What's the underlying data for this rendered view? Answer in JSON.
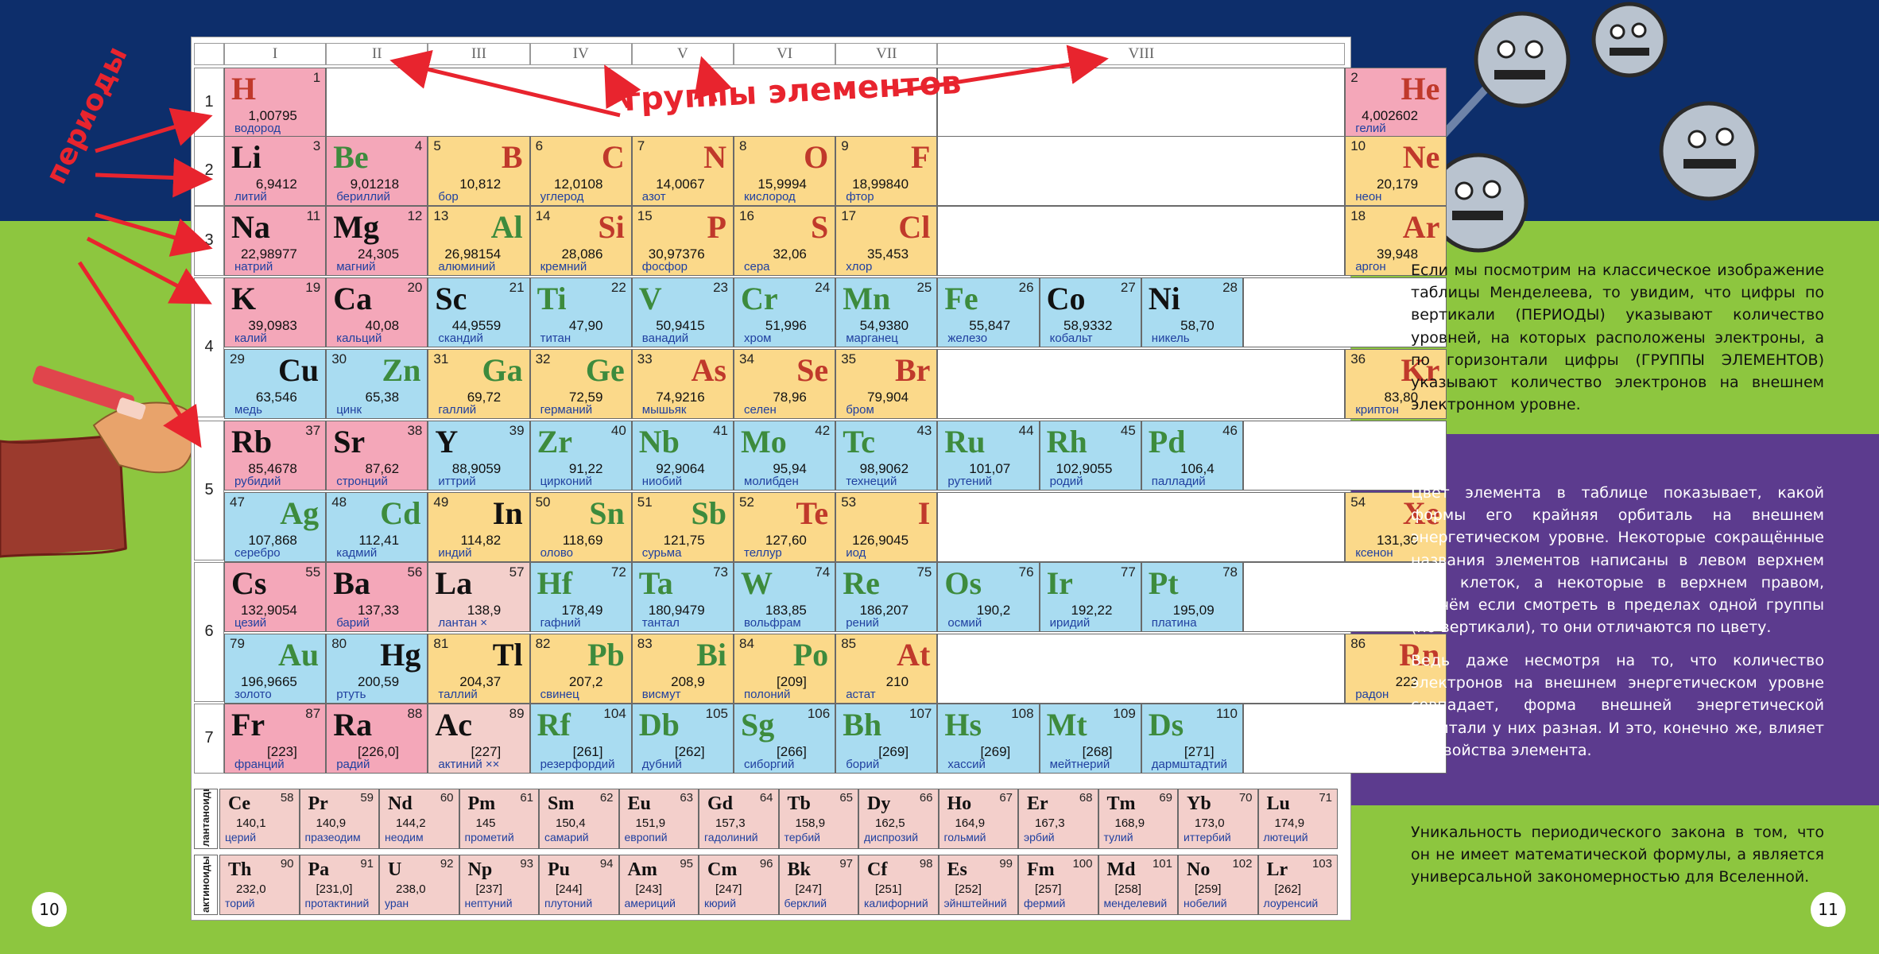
{
  "groups_label": "группы элементов",
  "periods_label": "периоды",
  "group_headers": [
    "I",
    "II",
    "III",
    "IV",
    "V",
    "VI",
    "VII",
    "VIII"
  ],
  "period_numbers": [
    "1",
    "2",
    "3",
    "4",
    "5",
    "6",
    "7"
  ],
  "colors": {
    "s": "#f4a7b9",
    "p": "#fbd98a",
    "d": "#a9dcf1",
    "f": "#f3cfcb"
  },
  "elements": [
    {
      "sym": "H",
      "num": "1",
      "mass": "1,00795",
      "name": "водород",
      "block": "s",
      "sc": "#c0392b",
      "nr": true
    },
    {
      "sym": "He",
      "num": "2",
      "mass": "4,002602",
      "name": "гелий",
      "block": "s",
      "sc": "#c0392b",
      "nr": false
    },
    {
      "sym": "Li",
      "num": "3",
      "mass": "6,9412",
      "name": "литий",
      "block": "s",
      "sc": "#111",
      "nr": true
    },
    {
      "sym": "Be",
      "num": "4",
      "mass": "9,01218",
      "name": "бериллий",
      "block": "s",
      "sc": "#3d8b3d",
      "nr": true
    },
    {
      "sym": "B",
      "num": "5",
      "mass": "10,812",
      "name": "бор",
      "block": "p",
      "sc": "#c0392b",
      "nr": false
    },
    {
      "sym": "C",
      "num": "6",
      "mass": "12,0108",
      "name": "углерод",
      "block": "p",
      "sc": "#c0392b",
      "nr": false
    },
    {
      "sym": "N",
      "num": "7",
      "mass": "14,0067",
      "name": "азот",
      "block": "p",
      "sc": "#c0392b",
      "nr": false
    },
    {
      "sym": "O",
      "num": "8",
      "mass": "15,9994",
      "name": "кислород",
      "block": "p",
      "sc": "#c0392b",
      "nr": false
    },
    {
      "sym": "F",
      "num": "9",
      "mass": "18,99840",
      "name": "фтор",
      "block": "p",
      "sc": "#c0392b",
      "nr": false
    },
    {
      "sym": "Ne",
      "num": "10",
      "mass": "20,179",
      "name": "неон",
      "block": "p",
      "sc": "#c0392b",
      "nr": false
    },
    {
      "sym": "Na",
      "num": "11",
      "mass": "22,98977",
      "name": "натрий",
      "block": "s",
      "sc": "#111",
      "nr": true
    },
    {
      "sym": "Mg",
      "num": "12",
      "mass": "24,305",
      "name": "магний",
      "block": "s",
      "sc": "#111",
      "nr": true
    },
    {
      "sym": "Al",
      "num": "13",
      "mass": "26,98154",
      "name": "алюминий",
      "block": "p",
      "sc": "#3d8b3d",
      "nr": false
    },
    {
      "sym": "Si",
      "num": "14",
      "mass": "28,086",
      "name": "кремний",
      "block": "p",
      "sc": "#c0392b",
      "nr": false
    },
    {
      "sym": "P",
      "num": "15",
      "mass": "30,97376",
      "name": "фосфор",
      "block": "p",
      "sc": "#c0392b",
      "nr": false
    },
    {
      "sym": "S",
      "num": "16",
      "mass": "32,06",
      "name": "сера",
      "block": "p",
      "sc": "#c0392b",
      "nr": false
    },
    {
      "sym": "Cl",
      "num": "17",
      "mass": "35,453",
      "name": "хлор",
      "block": "p",
      "sc": "#c0392b",
      "nr": false
    },
    {
      "sym": "Ar",
      "num": "18",
      "mass": "39,948",
      "name": "аргон",
      "block": "p",
      "sc": "#c0392b",
      "nr": false
    },
    {
      "sym": "K",
      "num": "19",
      "mass": "39,0983",
      "name": "калий",
      "block": "s",
      "sc": "#111",
      "nr": true
    },
    {
      "sym": "Ca",
      "num": "20",
      "mass": "40,08",
      "name": "кальций",
      "block": "s",
      "sc": "#111",
      "nr": true
    },
    {
      "sym": "Sc",
      "num": "21",
      "mass": "44,9559",
      "name": "скандий",
      "block": "d",
      "sc": "#111",
      "nr": true
    },
    {
      "sym": "Ti",
      "num": "22",
      "mass": "47,90",
      "name": "титан",
      "block": "d",
      "sc": "#3d8b3d",
      "nr": true
    },
    {
      "sym": "V",
      "num": "23",
      "mass": "50,9415",
      "name": "ванадий",
      "block": "d",
      "sc": "#3d8b3d",
      "nr": true
    },
    {
      "sym": "Cr",
      "num": "24",
      "mass": "51,996",
      "name": "хром",
      "block": "d",
      "sc": "#3d8b3d",
      "nr": true
    },
    {
      "sym": "Mn",
      "num": "25",
      "mass": "54,9380",
      "name": "марганец",
      "block": "d",
      "sc": "#3d8b3d",
      "nr": true
    },
    {
      "sym": "Fe",
      "num": "26",
      "mass": "55,847",
      "name": "железо",
      "block": "d",
      "sc": "#3d8b3d",
      "nr": true
    },
    {
      "sym": "Co",
      "num": "27",
      "mass": "58,9332",
      "name": "кобальт",
      "block": "d",
      "sc": "#111",
      "nr": true
    },
    {
      "sym": "Ni",
      "num": "28",
      "mass": "58,70",
      "name": "никель",
      "block": "d",
      "sc": "#111",
      "nr": true
    },
    {
      "sym": "Cu",
      "num": "29",
      "mass": "63,546",
      "name": "медь",
      "block": "d",
      "sc": "#111",
      "nr": false
    },
    {
      "sym": "Zn",
      "num": "30",
      "mass": "65,38",
      "name": "цинк",
      "block": "d",
      "sc": "#3d8b3d",
      "nr": false
    },
    {
      "sym": "Ga",
      "num": "31",
      "mass": "69,72",
      "name": "галлий",
      "block": "p",
      "sc": "#3d8b3d",
      "nr": false
    },
    {
      "sym": "Ge",
      "num": "32",
      "mass": "72,59",
      "name": "германий",
      "block": "p",
      "sc": "#3d8b3d",
      "nr": false
    },
    {
      "sym": "As",
      "num": "33",
      "mass": "74,9216",
      "name": "мышьяк",
      "block": "p",
      "sc": "#c0392b",
      "nr": false
    },
    {
      "sym": "Se",
      "num": "34",
      "mass": "78,96",
      "name": "селен",
      "block": "p",
      "sc": "#c0392b",
      "nr": false
    },
    {
      "sym": "Br",
      "num": "35",
      "mass": "79,904",
      "name": "бром",
      "block": "p",
      "sc": "#c0392b",
      "nr": false
    },
    {
      "sym": "Kr",
      "num": "36",
      "mass": "83,80",
      "name": "криптон",
      "block": "p",
      "sc": "#c0392b",
      "nr": false
    },
    {
      "sym": "Rb",
      "num": "37",
      "mass": "85,4678",
      "name": "рубидий",
      "block": "s",
      "sc": "#111",
      "nr": true
    },
    {
      "sym": "Sr",
      "num": "38",
      "mass": "87,62",
      "name": "стронций",
      "block": "s",
      "sc": "#111",
      "nr": true
    },
    {
      "sym": "Y",
      "num": "39",
      "mass": "88,9059",
      "name": "иттрий",
      "block": "d",
      "sc": "#111",
      "nr": true
    },
    {
      "sym": "Zr",
      "num": "40",
      "mass": "91,22",
      "name": "цирконий",
      "block": "d",
      "sc": "#3d8b3d",
      "nr": true
    },
    {
      "sym": "Nb",
      "num": "41",
      "mass": "92,9064",
      "name": "ниобий",
      "block": "d",
      "sc": "#3d8b3d",
      "nr": true
    },
    {
      "sym": "Mo",
      "num": "42",
      "mass": "95,94",
      "name": "молибден",
      "block": "d",
      "sc": "#3d8b3d",
      "nr": true
    },
    {
      "sym": "Tc",
      "num": "43",
      "mass": "98,9062",
      "name": "технеций",
      "block": "d",
      "sc": "#3d8b3d",
      "nr": true
    },
    {
      "sym": "Ru",
      "num": "44",
      "mass": "101,07",
      "name": "рутений",
      "block": "d",
      "sc": "#3d8b3d",
      "nr": true
    },
    {
      "sym": "Rh",
      "num": "45",
      "mass": "102,9055",
      "name": "родий",
      "block": "d",
      "sc": "#3d8b3d",
      "nr": true
    },
    {
      "sym": "Pd",
      "num": "46",
      "mass": "106,4",
      "name": "палладий",
      "block": "d",
      "sc": "#3d8b3d",
      "nr": true
    },
    {
      "sym": "Ag",
      "num": "47",
      "mass": "107,868",
      "name": "серебро",
      "block": "d",
      "sc": "#3d8b3d",
      "nr": false
    },
    {
      "sym": "Cd",
      "num": "48",
      "mass": "112,41",
      "name": "кадмий",
      "block": "d",
      "sc": "#3d8b3d",
      "nr": false
    },
    {
      "sym": "In",
      "num": "49",
      "mass": "114,82",
      "name": "индий",
      "block": "p",
      "sc": "#111",
      "nr": false
    },
    {
      "sym": "Sn",
      "num": "50",
      "mass": "118,69",
      "name": "олово",
      "block": "p",
      "sc": "#3d8b3d",
      "nr": false
    },
    {
      "sym": "Sb",
      "num": "51",
      "mass": "121,75",
      "name": "сурьма",
      "block": "p",
      "sc": "#3d8b3d",
      "nr": false
    },
    {
      "sym": "Te",
      "num": "52",
      "mass": "127,60",
      "name": "теллур",
      "block": "p",
      "sc": "#c0392b",
      "nr": false
    },
    {
      "sym": "I",
      "num": "53",
      "mass": "126,9045",
      "name": "иод",
      "block": "p",
      "sc": "#c0392b",
      "nr": false
    },
    {
      "sym": "Xe",
      "num": "54",
      "mass": "131,30",
      "name": "ксенон",
      "block": "p",
      "sc": "#c0392b",
      "nr": false
    },
    {
      "sym": "Cs",
      "num": "55",
      "mass": "132,9054",
      "name": "цезий",
      "block": "s",
      "sc": "#111",
      "nr": true
    },
    {
      "sym": "Ba",
      "num": "56",
      "mass": "137,33",
      "name": "барий",
      "block": "s",
      "sc": "#111",
      "nr": true
    },
    {
      "sym": "La",
      "num": "57",
      "mass": "138,9",
      "name": "лантан ×",
      "block": "f",
      "sc": "#111",
      "nr": true
    },
    {
      "sym": "Hf",
      "num": "72",
      "mass": "178,49",
      "name": "гафний",
      "block": "d",
      "sc": "#3d8b3d",
      "nr": true
    },
    {
      "sym": "Ta",
      "num": "73",
      "mass": "180,9479",
      "name": "тантал",
      "block": "d",
      "sc": "#3d8b3d",
      "nr": true
    },
    {
      "sym": "W",
      "num": "74",
      "mass": "183,85",
      "name": "вольфрам",
      "block": "d",
      "sc": "#3d8b3d",
      "nr": true
    },
    {
      "sym": "Re",
      "num": "75",
      "mass": "186,207",
      "name": "рений",
      "block": "d",
      "sc": "#3d8b3d",
      "nr": true
    },
    {
      "sym": "Os",
      "num": "76",
      "mass": "190,2",
      "name": "осмий",
      "block": "d",
      "sc": "#3d8b3d",
      "nr": true
    },
    {
      "sym": "Ir",
      "num": "77",
      "mass": "192,22",
      "name": "иридий",
      "block": "d",
      "sc": "#3d8b3d",
      "nr": true
    },
    {
      "sym": "Pt",
      "num": "78",
      "mass": "195,09",
      "name": "платина",
      "block": "d",
      "sc": "#3d8b3d",
      "nr": true
    },
    {
      "sym": "Au",
      "num": "79",
      "mass": "196,9665",
      "name": "золото",
      "block": "d",
      "sc": "#3d8b3d",
      "nr": false
    },
    {
      "sym": "Hg",
      "num": "80",
      "mass": "200,59",
      "name": "ртуть",
      "block": "d",
      "sc": "#111",
      "nr": false
    },
    {
      "sym": "Tl",
      "num": "81",
      "mass": "204,37",
      "name": "таллий",
      "block": "p",
      "sc": "#111",
      "nr": false
    },
    {
      "sym": "Pb",
      "num": "82",
      "mass": "207,2",
      "name": "свинец",
      "block": "p",
      "sc": "#3d8b3d",
      "nr": false
    },
    {
      "sym": "Bi",
      "num": "83",
      "mass": "208,9",
      "name": "висмут",
      "block": "p",
      "sc": "#3d8b3d",
      "nr": false
    },
    {
      "sym": "Po",
      "num": "84",
      "mass": "[209]",
      "name": "полоний",
      "block": "p",
      "sc": "#3d8b3d",
      "nr": false
    },
    {
      "sym": "At",
      "num": "85",
      "mass": "210",
      "name": "астат",
      "block": "p",
      "sc": "#c0392b",
      "nr": false
    },
    {
      "sym": "Rn",
      "num": "86",
      "mass": "222",
      "name": "радон",
      "block": "p",
      "sc": "#c0392b",
      "nr": false
    },
    {
      "sym": "Fr",
      "num": "87",
      "mass": "[223]",
      "name": "франций",
      "block": "s",
      "sc": "#111",
      "nr": true
    },
    {
      "sym": "Ra",
      "num": "88",
      "mass": "[226,0]",
      "name": "радий",
      "block": "s",
      "sc": "#111",
      "nr": true
    },
    {
      "sym": "Ac",
      "num": "89",
      "mass": "[227]",
      "name": "актиний ××",
      "block": "f",
      "sc": "#111",
      "nr": true
    },
    {
      "sym": "Rf",
      "num": "104",
      "mass": "[261]",
      "name": "резерфордий",
      "block": "d",
      "sc": "#3d8b3d",
      "nr": true
    },
    {
      "sym": "Db",
      "num": "105",
      "mass": "[262]",
      "name": "дубний",
      "block": "d",
      "sc": "#3d8b3d",
      "nr": true
    },
    {
      "sym": "Sg",
      "num": "106",
      "mass": "[266]",
      "name": "сиборгий",
      "block": "d",
      "sc": "#3d8b3d",
      "nr": true
    },
    {
      "sym": "Bh",
      "num": "107",
      "mass": "[269]",
      "name": "борий",
      "block": "d",
      "sc": "#3d8b3d",
      "nr": true
    },
    {
      "sym": "Hs",
      "num": "108",
      "mass": "[269]",
      "name": "хассий",
      "block": "d",
      "sc": "#3d8b3d",
      "nr": true
    },
    {
      "sym": "Mt",
      "num": "109",
      "mass": "[268]",
      "name": "мейтнерий",
      "block": "d",
      "sc": "#3d8b3d",
      "nr": true
    },
    {
      "sym": "Ds",
      "num": "110",
      "mass": "[271]",
      "name": "дармштадтий",
      "block": "d",
      "sc": "#3d8b3d",
      "nr": true
    }
  ],
  "lanthanides_label": "лантаноиды",
  "lanthanides": [
    {
      "sym": "Ce",
      "num": "58",
      "mass": "140,1",
      "name": "церий"
    },
    {
      "sym": "Pr",
      "num": "59",
      "mass": "140,9",
      "name": "празеодим"
    },
    {
      "sym": "Nd",
      "num": "60",
      "mass": "144,2",
      "name": "неодим"
    },
    {
      "sym": "Pm",
      "num": "61",
      "mass": "145",
      "name": "прометий"
    },
    {
      "sym": "Sm",
      "num": "62",
      "mass": "150,4",
      "name": "самарий"
    },
    {
      "sym": "Eu",
      "num": "63",
      "mass": "151,9",
      "name": "европий"
    },
    {
      "sym": "Gd",
      "num": "64",
      "mass": "157,3",
      "name": "гадолиний"
    },
    {
      "sym": "Tb",
      "num": "65",
      "mass": "158,9",
      "name": "тербий"
    },
    {
      "sym": "Dy",
      "num": "66",
      "mass": "162,5",
      "name": "диспрозий"
    },
    {
      "sym": "Ho",
      "num": "67",
      "mass": "164,9",
      "name": "гольмий"
    },
    {
      "sym": "Er",
      "num": "68",
      "mass": "167,3",
      "name": "эрбий"
    },
    {
      "sym": "Tm",
      "num": "69",
      "mass": "168,9",
      "name": "тулий"
    },
    {
      "sym": "Yb",
      "num": "70",
      "mass": "173,0",
      "name": "иттербий"
    },
    {
      "sym": "Lu",
      "num": "71",
      "mass": "174,9",
      "name": "лютеций"
    }
  ],
  "actinides_label": "актиноиды",
  "actinides": [
    {
      "sym": "Th",
      "num": "90",
      "mass": "232,0",
      "name": "торий"
    },
    {
      "sym": "Pa",
      "num": "91",
      "mass": "[231,0]",
      "name": "протактиний"
    },
    {
      "sym": "U",
      "num": "92",
      "mass": "238,0",
      "name": "уран"
    },
    {
      "sym": "Np",
      "num": "93",
      "mass": "[237]",
      "name": "нептуний"
    },
    {
      "sym": "Pu",
      "num": "94",
      "mass": "[244]",
      "name": "плутоний"
    },
    {
      "sym": "Am",
      "num": "95",
      "mass": "[243]",
      "name": "америций"
    },
    {
      "sym": "Cm",
      "num": "96",
      "mass": "[247]",
      "name": "кюрий"
    },
    {
      "sym": "Bk",
      "num": "97",
      "mass": "[247]",
      "name": "берклий"
    },
    {
      "sym": "Cf",
      "num": "98",
      "mass": "[251]",
      "name": "калифорний"
    },
    {
      "sym": "Es",
      "num": "99",
      "mass": "[252]",
      "name": "эйнштейний"
    },
    {
      "sym": "Fm",
      "num": "100",
      "mass": "[257]",
      "name": "фермий"
    },
    {
      "sym": "Md",
      "num": "101",
      "mass": "[258]",
      "name": "менделевий"
    },
    {
      "sym": "No",
      "num": "102",
      "mass": "[259]",
      "name": "нобелий"
    },
    {
      "sym": "Lr",
      "num": "103",
      "mass": "[262]",
      "name": "лоуренсий"
    }
  ],
  "text": {
    "p1": "Если мы посмотрим на классическое изображение таблицы Менделеева, то увидим, что цифры по вертикали (ПЕРИОДЫ) указывают количество уровней, на которых расположены электроны, а по горизонтали цифры (ГРУППЫ ЭЛЕМЕНТОВ) указывают количество электронов на внешнем электронном уровне.",
    "p2": "Цвет элемента в таблице показывает, какой формы его крайняя орбиталь на внешнем энергетическом уровне. Некоторые сокращённые названия элементов написаны в левом верхнем углу клеток, а некоторые в верхнем правом, причём если смотреть в пределах одной группы (по вертикали), то они отличаются по цвету.",
    "p3": "Ведь даже несмотря на то, что количество электронов на внешнем энергетическом уровне совпадает, форма внешней энергетической орбитали у них разная. И это, конечно же, влияет на свойства элемента.",
    "p4": "Уникальность периодического закона в том, что он не имеет математической формулы, а является универсальной закономерностью для Вселенной."
  },
  "page_left": "10",
  "page_right": "11"
}
